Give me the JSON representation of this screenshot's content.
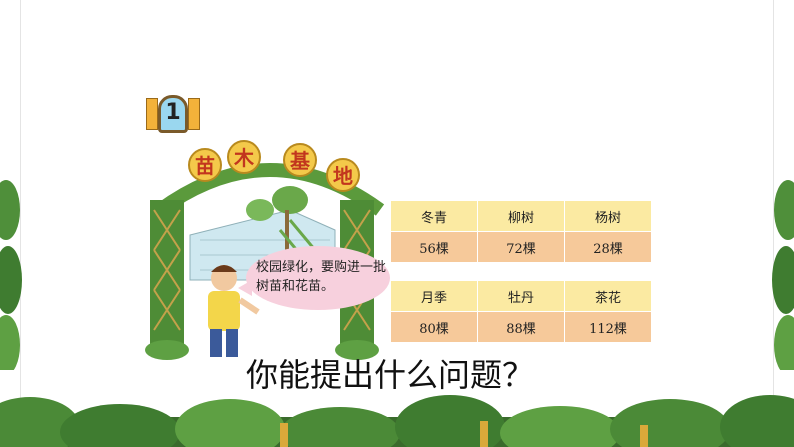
{
  "problem_number": "1",
  "sign_chars": [
    "苗",
    "木",
    "基",
    "地"
  ],
  "speech": "校园绿化，要购进一批树苗和花苗。",
  "table1": {
    "headers": [
      "冬青",
      "柳树",
      "杨树"
    ],
    "values": [
      "56棵",
      "72棵",
      "28棵"
    ]
  },
  "table2": {
    "headers": [
      "月季",
      "牡丹",
      "茶花"
    ],
    "values": [
      "80棵",
      "88棵",
      "112棵"
    ]
  },
  "question": "你能提出什么问题？",
  "colors": {
    "table_header": "#fbeaa2",
    "table_value": "#f6c99a",
    "bubble": "#f7d0dd",
    "sign_text": "#c2361e"
  }
}
